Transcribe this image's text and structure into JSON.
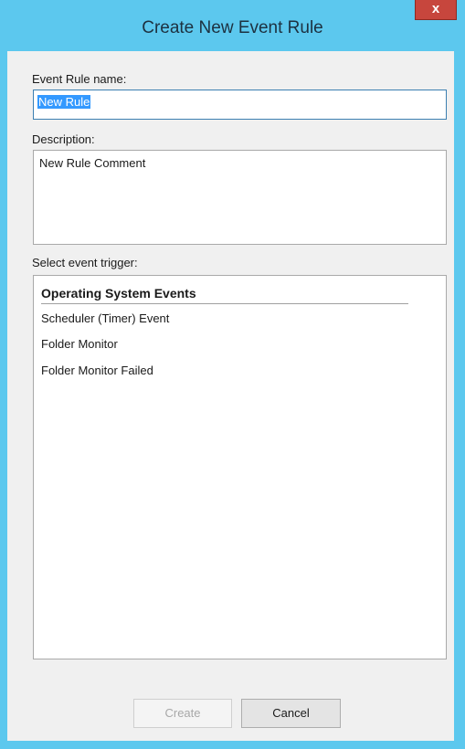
{
  "window": {
    "title": "Create New Event Rule",
    "close_glyph": "x"
  },
  "form": {
    "name_label": "Event Rule name:",
    "name_value": "New Rule",
    "description_label": "Description:",
    "description_value": "New Rule Comment",
    "trigger_label": "Select event trigger:"
  },
  "triggers": {
    "group_header": "Operating System Events",
    "items": [
      "Scheduler (Timer) Event",
      "Folder Monitor",
      "Folder Monitor Failed"
    ],
    "selected": null
  },
  "buttons": {
    "create_label": "Create",
    "create_enabled": false,
    "cancel_label": "Cancel"
  },
  "colors": {
    "frame": "#5cc8ee",
    "close_button": "#c7463d",
    "selection": "#3399ff",
    "dialog_background": "#f0f0f0"
  }
}
